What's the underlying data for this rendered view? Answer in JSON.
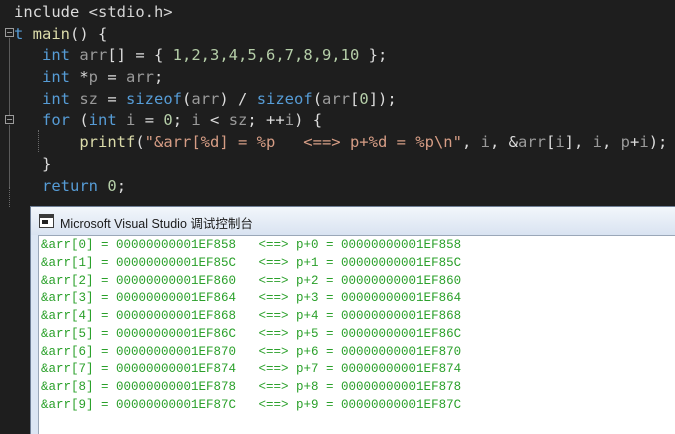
{
  "editor": {
    "lines": [
      [
        {
          "t": "include ",
          "c": "inc"
        },
        {
          "t": "<stdio.h>",
          "c": "pre"
        }
      ],
      [
        {
          "t": "t ",
          "c": "kw"
        },
        {
          "t": "main",
          "c": "fn"
        },
        {
          "t": "() {",
          "c": "p"
        }
      ],
      [
        {
          "t": "   ",
          "c": "p"
        },
        {
          "t": "int",
          "c": "kw"
        },
        {
          "t": " ",
          "c": "p"
        },
        {
          "t": "arr",
          "c": "vr"
        },
        {
          "t": "[] = { ",
          "c": "p"
        },
        {
          "t": "1,2,3,4,5,6,7,8,9,10",
          "c": "num"
        },
        {
          "t": " };",
          "c": "p"
        }
      ],
      [
        {
          "t": "   ",
          "c": "p"
        },
        {
          "t": "int",
          "c": "kw"
        },
        {
          "t": " *",
          "c": "p"
        },
        {
          "t": "p",
          "c": "vr"
        },
        {
          "t": " = ",
          "c": "p"
        },
        {
          "t": "arr",
          "c": "vr"
        },
        {
          "t": ";",
          "c": "p"
        }
      ],
      [
        {
          "t": "   ",
          "c": "p"
        },
        {
          "t": "int",
          "c": "kw"
        },
        {
          "t": " ",
          "c": "p"
        },
        {
          "t": "sz",
          "c": "vr"
        },
        {
          "t": " = ",
          "c": "p"
        },
        {
          "t": "sizeof",
          "c": "kw"
        },
        {
          "t": "(",
          "c": "p"
        },
        {
          "t": "arr",
          "c": "vr"
        },
        {
          "t": ") / ",
          "c": "p"
        },
        {
          "t": "sizeof",
          "c": "kw"
        },
        {
          "t": "(",
          "c": "p"
        },
        {
          "t": "arr",
          "c": "vr"
        },
        {
          "t": "[",
          "c": "p"
        },
        {
          "t": "0",
          "c": "num"
        },
        {
          "t": "]);",
          "c": "p"
        }
      ],
      [
        {
          "t": "   ",
          "c": "p"
        },
        {
          "t": "for",
          "c": "kw"
        },
        {
          "t": " (",
          "c": "p"
        },
        {
          "t": "int",
          "c": "kw"
        },
        {
          "t": " ",
          "c": "p"
        },
        {
          "t": "i",
          "c": "vr"
        },
        {
          "t": " = ",
          "c": "p"
        },
        {
          "t": "0",
          "c": "num"
        },
        {
          "t": "; ",
          "c": "p"
        },
        {
          "t": "i",
          "c": "vr"
        },
        {
          "t": " < ",
          "c": "p"
        },
        {
          "t": "sz",
          "c": "vr"
        },
        {
          "t": "; ++",
          "c": "p"
        },
        {
          "t": "i",
          "c": "vr"
        },
        {
          "t": ") {",
          "c": "p"
        }
      ],
      [
        {
          "t": "       ",
          "c": "p"
        },
        {
          "t": "printf",
          "c": "fn"
        },
        {
          "t": "(",
          "c": "p"
        },
        {
          "t": "\"&arr[%d] = %p   <==> p+%d = %p\\n\"",
          "c": "str"
        },
        {
          "t": ", ",
          "c": "p"
        },
        {
          "t": "i",
          "c": "vr"
        },
        {
          "t": ", &",
          "c": "p"
        },
        {
          "t": "arr",
          "c": "vr"
        },
        {
          "t": "[",
          "c": "p"
        },
        {
          "t": "i",
          "c": "vr"
        },
        {
          "t": "], ",
          "c": "p"
        },
        {
          "t": "i",
          "c": "vr"
        },
        {
          "t": ", ",
          "c": "p"
        },
        {
          "t": "p",
          "c": "vr"
        },
        {
          "t": "+",
          "c": "p"
        },
        {
          "t": "i",
          "c": "vr"
        },
        {
          "t": ");",
          "c": "p"
        }
      ],
      [
        {
          "t": "   }",
          "c": "p"
        }
      ],
      [
        {
          "t": "   ",
          "c": "p"
        },
        {
          "t": "return",
          "c": "kw"
        },
        {
          "t": " ",
          "c": "p"
        },
        {
          "t": "0",
          "c": "num"
        },
        {
          "t": ";",
          "c": "p"
        }
      ]
    ]
  },
  "console": {
    "title": "Microsoft Visual Studio 调试控制台",
    "output_lines": [
      "&arr[0] = 00000000001EF858   <==> p+0 = 00000000001EF858",
      "&arr[1] = 00000000001EF85C   <==> p+1 = 00000000001EF85C",
      "&arr[2] = 00000000001EF860   <==> p+2 = 00000000001EF860",
      "&arr[3] = 00000000001EF864   <==> p+3 = 00000000001EF864",
      "&arr[4] = 00000000001EF868   <==> p+4 = 00000000001EF868",
      "&arr[5] = 00000000001EF86C   <==> p+5 = 00000000001EF86C",
      "&arr[6] = 00000000001EF870   <==> p+6 = 00000000001EF870",
      "&arr[7] = 00000000001EF874   <==> p+7 = 00000000001EF874",
      "&arr[8] = 00000000001EF878   <==> p+8 = 00000000001EF878",
      "&arr[9] = 00000000001EF87C   <==> p+9 = 00000000001EF87C"
    ]
  },
  "colors": {
    "editor_bg": "#1e1e1e",
    "keyword": "#569cd6",
    "function": "#dcdcaa",
    "string": "#d69d85",
    "number": "#b5cea8",
    "console_text": "#2aa02a"
  },
  "icons": [
    "collapse-main-icon",
    "collapse-for-icon",
    "console-app-icon"
  ]
}
